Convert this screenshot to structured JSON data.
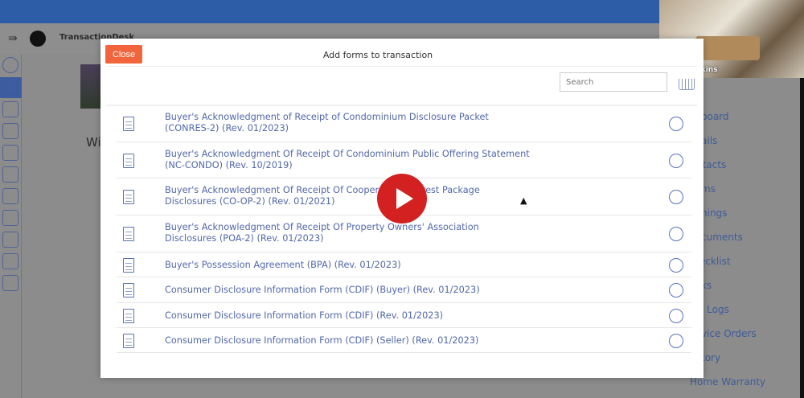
{
  "app": {
    "brand": "TransactionDesk",
    "page_heading_fragment": "Wi"
  },
  "webcam": {
    "participant": "Susan Jenkins"
  },
  "modal": {
    "title": "Add forms to transaction",
    "close_label": "Close",
    "search_placeholder": "Search",
    "forms": [
      {
        "label": "",
        "selected": false
      },
      {
        "label": "Buyer's Acknowledgment of Receipt of Condominium Disclosure Packet",
        "label2": "(CONRES-2) (Rev. 01/2023)",
        "selected": false
      },
      {
        "label": "Buyer's Acknowledgment Of Receipt Of Condominium Public Offering Statement",
        "label2": "(NC-CONDO) (Rev. 10/2019)",
        "selected": false
      },
      {
        "label": "Buyer's Acknowledgment Of Receipt Of Cooperative Interest Package",
        "label2": "Disclosures (CO-OP-2) (Rev. 01/2021)",
        "selected": false
      },
      {
        "label": "Buyer's Acknowledgment Of Receipt Of Property Owners' Association",
        "label2": "Disclosures (POA-2) (Rev. 01/2023)",
        "selected": false
      },
      {
        "label": "Buyer's Possession Agreement (BPA) (Rev. 01/2023)",
        "selected": false
      },
      {
        "label": "Consumer Disclosure Information Form (CDIF) (Buyer) (Rev. 01/2023)",
        "selected": false
      },
      {
        "label": "Consumer Disclosure Information Form (CDIF) (Rev. 01/2023)",
        "selected": false
      },
      {
        "label": "Consumer Disclosure Information Form (CDIF) (Seller) (Rev. 01/2023)",
        "selected": false
      }
    ]
  },
  "right_nav": [
    "shboard",
    "ails",
    "ntacts",
    "ms",
    "nings",
    "cuments",
    "ecklist",
    "ks",
    "l Logs",
    "vice Orders",
    "tory",
    "Home Warranty"
  ],
  "colors": {
    "topbar": "#2d5da6",
    "close_button": "#f2643c",
    "link": "#5268aa",
    "play": "#d32020"
  }
}
